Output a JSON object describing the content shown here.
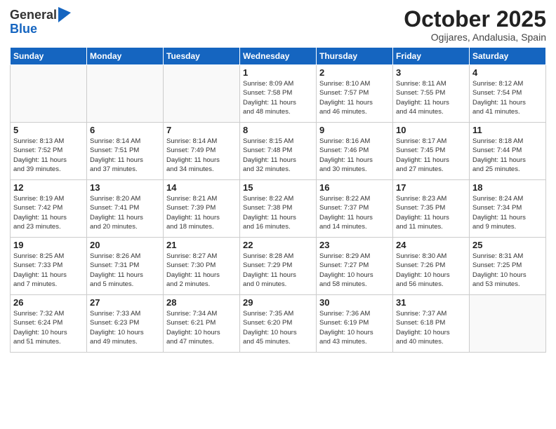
{
  "logo": {
    "general": "General",
    "blue": "Blue"
  },
  "title": {
    "month_year": "October 2025",
    "location": "Ogijares, Andalusia, Spain"
  },
  "headers": [
    "Sunday",
    "Monday",
    "Tuesday",
    "Wednesday",
    "Thursday",
    "Friday",
    "Saturday"
  ],
  "weeks": [
    [
      {
        "day": "",
        "info": ""
      },
      {
        "day": "",
        "info": ""
      },
      {
        "day": "",
        "info": ""
      },
      {
        "day": "1",
        "info": "Sunrise: 8:09 AM\nSunset: 7:58 PM\nDaylight: 11 hours\nand 48 minutes."
      },
      {
        "day": "2",
        "info": "Sunrise: 8:10 AM\nSunset: 7:57 PM\nDaylight: 11 hours\nand 46 minutes."
      },
      {
        "day": "3",
        "info": "Sunrise: 8:11 AM\nSunset: 7:55 PM\nDaylight: 11 hours\nand 44 minutes."
      },
      {
        "day": "4",
        "info": "Sunrise: 8:12 AM\nSunset: 7:54 PM\nDaylight: 11 hours\nand 41 minutes."
      }
    ],
    [
      {
        "day": "5",
        "info": "Sunrise: 8:13 AM\nSunset: 7:52 PM\nDaylight: 11 hours\nand 39 minutes."
      },
      {
        "day": "6",
        "info": "Sunrise: 8:14 AM\nSunset: 7:51 PM\nDaylight: 11 hours\nand 37 minutes."
      },
      {
        "day": "7",
        "info": "Sunrise: 8:14 AM\nSunset: 7:49 PM\nDaylight: 11 hours\nand 34 minutes."
      },
      {
        "day": "8",
        "info": "Sunrise: 8:15 AM\nSunset: 7:48 PM\nDaylight: 11 hours\nand 32 minutes."
      },
      {
        "day": "9",
        "info": "Sunrise: 8:16 AM\nSunset: 7:46 PM\nDaylight: 11 hours\nand 30 minutes."
      },
      {
        "day": "10",
        "info": "Sunrise: 8:17 AM\nSunset: 7:45 PM\nDaylight: 11 hours\nand 27 minutes."
      },
      {
        "day": "11",
        "info": "Sunrise: 8:18 AM\nSunset: 7:44 PM\nDaylight: 11 hours\nand 25 minutes."
      }
    ],
    [
      {
        "day": "12",
        "info": "Sunrise: 8:19 AM\nSunset: 7:42 PM\nDaylight: 11 hours\nand 23 minutes."
      },
      {
        "day": "13",
        "info": "Sunrise: 8:20 AM\nSunset: 7:41 PM\nDaylight: 11 hours\nand 20 minutes."
      },
      {
        "day": "14",
        "info": "Sunrise: 8:21 AM\nSunset: 7:39 PM\nDaylight: 11 hours\nand 18 minutes."
      },
      {
        "day": "15",
        "info": "Sunrise: 8:22 AM\nSunset: 7:38 PM\nDaylight: 11 hours\nand 16 minutes."
      },
      {
        "day": "16",
        "info": "Sunrise: 8:22 AM\nSunset: 7:37 PM\nDaylight: 11 hours\nand 14 minutes."
      },
      {
        "day": "17",
        "info": "Sunrise: 8:23 AM\nSunset: 7:35 PM\nDaylight: 11 hours\nand 11 minutes."
      },
      {
        "day": "18",
        "info": "Sunrise: 8:24 AM\nSunset: 7:34 PM\nDaylight: 11 hours\nand 9 minutes."
      }
    ],
    [
      {
        "day": "19",
        "info": "Sunrise: 8:25 AM\nSunset: 7:33 PM\nDaylight: 11 hours\nand 7 minutes."
      },
      {
        "day": "20",
        "info": "Sunrise: 8:26 AM\nSunset: 7:31 PM\nDaylight: 11 hours\nand 5 minutes."
      },
      {
        "day": "21",
        "info": "Sunrise: 8:27 AM\nSunset: 7:30 PM\nDaylight: 11 hours\nand 2 minutes."
      },
      {
        "day": "22",
        "info": "Sunrise: 8:28 AM\nSunset: 7:29 PM\nDaylight: 11 hours\nand 0 minutes."
      },
      {
        "day": "23",
        "info": "Sunrise: 8:29 AM\nSunset: 7:27 PM\nDaylight: 10 hours\nand 58 minutes."
      },
      {
        "day": "24",
        "info": "Sunrise: 8:30 AM\nSunset: 7:26 PM\nDaylight: 10 hours\nand 56 minutes."
      },
      {
        "day": "25",
        "info": "Sunrise: 8:31 AM\nSunset: 7:25 PM\nDaylight: 10 hours\nand 53 minutes."
      }
    ],
    [
      {
        "day": "26",
        "info": "Sunrise: 7:32 AM\nSunset: 6:24 PM\nDaylight: 10 hours\nand 51 minutes."
      },
      {
        "day": "27",
        "info": "Sunrise: 7:33 AM\nSunset: 6:23 PM\nDaylight: 10 hours\nand 49 minutes."
      },
      {
        "day": "28",
        "info": "Sunrise: 7:34 AM\nSunset: 6:21 PM\nDaylight: 10 hours\nand 47 minutes."
      },
      {
        "day": "29",
        "info": "Sunrise: 7:35 AM\nSunset: 6:20 PM\nDaylight: 10 hours\nand 45 minutes."
      },
      {
        "day": "30",
        "info": "Sunrise: 7:36 AM\nSunset: 6:19 PM\nDaylight: 10 hours\nand 43 minutes."
      },
      {
        "day": "31",
        "info": "Sunrise: 7:37 AM\nSunset: 6:18 PM\nDaylight: 10 hours\nand 40 minutes."
      },
      {
        "day": "",
        "info": ""
      }
    ]
  ]
}
